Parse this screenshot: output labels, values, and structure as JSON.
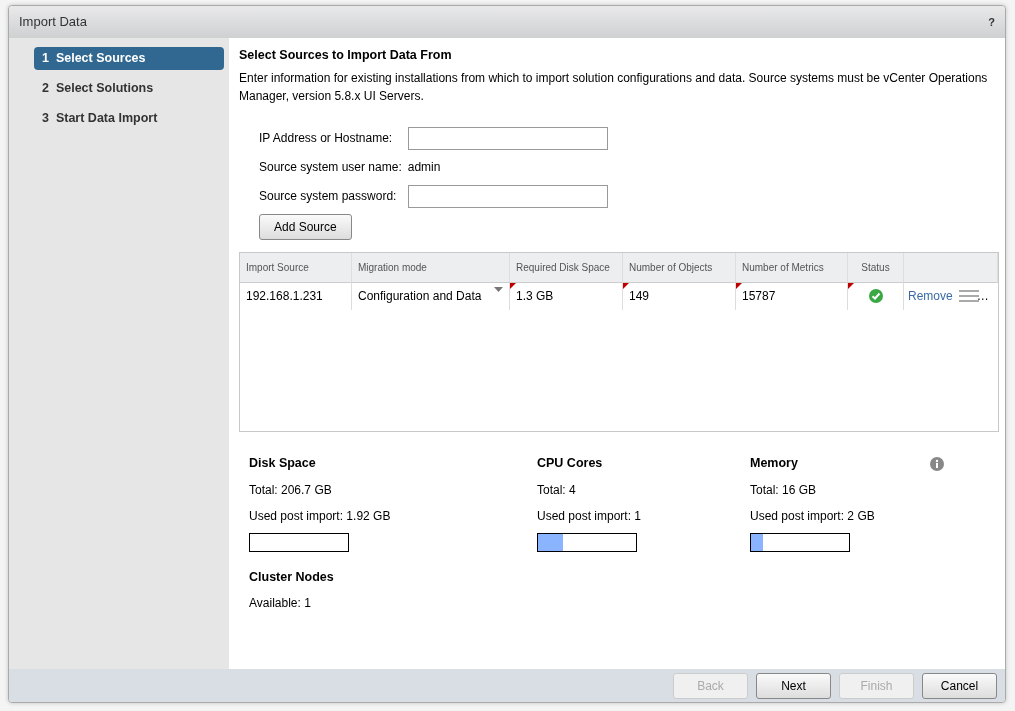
{
  "window": {
    "title": "Import Data",
    "help": "?"
  },
  "steps": [
    {
      "label": "1  Select Sources",
      "selected": true
    },
    {
      "label": "2  Select Solutions",
      "selected": false
    },
    {
      "label": "3  Start Data Import",
      "selected": false
    }
  ],
  "heading": "Select Sources to Import Data From",
  "description": "Enter information for existing installations from which to import solution configurations and data. Source systems must be vCenter Operations Manager, version 5.8.x UI Servers.",
  "form": [
    {
      "kind": "input",
      "label": "IP Address or Hostname:"
    },
    {
      "kind": "text",
      "label": "Source system user name:",
      "value": "admin"
    },
    {
      "kind": "input",
      "label": "Source system password:"
    }
  ],
  "add_button": "Add Source",
  "table": {
    "columns": [
      "Import Source",
      "Migration mode",
      "Required Disk Space",
      "Number of Objects",
      "Number of Metrics",
      "Status"
    ],
    "rows": [
      {
        "cells": [
          {
            "text": "192.168.1.231",
            "flagged": false
          },
          {
            "text": "Configuration and Data",
            "flagged": false,
            "kind": "dropdown"
          },
          {
            "text": "1.3 GB",
            "flagged": true
          },
          {
            "text": "149",
            "flagged": true
          },
          {
            "text": "15787",
            "flagged": true
          },
          {
            "kind": "status",
            "ok": true,
            "flagged": true
          }
        ],
        "action": "Remove",
        "more": "…"
      }
    ]
  },
  "resources": [
    {
      "title": "Disk Space",
      "total": "Total: 206.7 GB",
      "used": "Used post import: 1.92 GB",
      "level": 0
    },
    {
      "title": "CPU Cores",
      "total": "Total: 4",
      "used": "Used post import: 1",
      "level": 0.25
    },
    {
      "title": "Memory",
      "total": "Total: 16 GB",
      "used": "Used post import: 2 GB",
      "level": 0.125
    }
  ],
  "cluster": {
    "title": "Cluster Nodes",
    "available": "Available: 1"
  },
  "buttons": [
    {
      "label": "Back",
      "disabled": true
    },
    {
      "label": "Next",
      "disabled": false
    },
    {
      "label": "Finish",
      "disabled": true
    },
    {
      "label": "Cancel",
      "disabled": false
    }
  ]
}
